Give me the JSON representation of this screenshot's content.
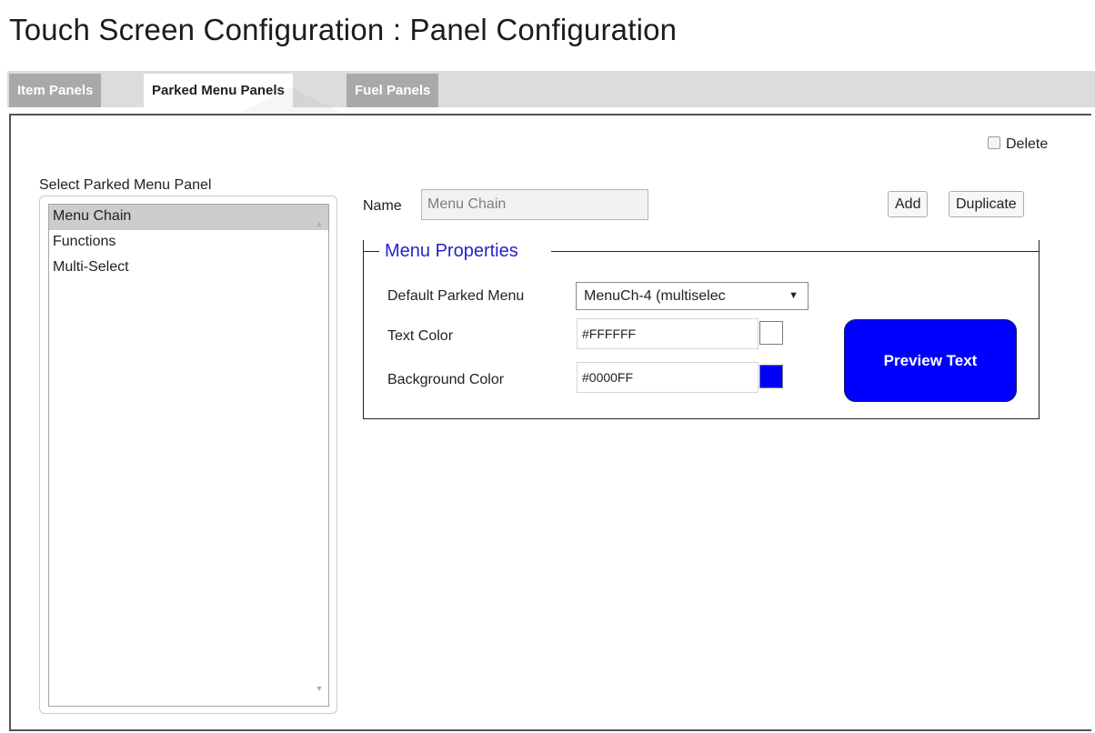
{
  "page": {
    "title": "Touch Screen Configuration : Panel Configuration"
  },
  "tabs": [
    {
      "label": "Item Panels",
      "active": false
    },
    {
      "label": "Parked Menu Panels",
      "active": true
    },
    {
      "label": "Fuel Panels",
      "active": false
    }
  ],
  "delete": {
    "label": "Delete",
    "checked": false
  },
  "panel_list": {
    "label": "Select Parked Menu Panel",
    "items": [
      "Menu Chain",
      "Functions",
      "Multi-Select"
    ],
    "selected": "Menu Chain"
  },
  "name_field": {
    "label": "Name",
    "value": "Menu Chain"
  },
  "buttons": {
    "add": "Add",
    "duplicate": "Duplicate"
  },
  "menu_properties": {
    "legend": "Menu Properties",
    "default_parked_menu": {
      "label": "Default Parked Menu",
      "value": "MenuCh-4 (multiselec"
    },
    "text_color": {
      "label": "Text Color",
      "value": "#FFFFFF"
    },
    "background_color": {
      "label": "Background Color",
      "value": "#0000FF"
    },
    "preview": {
      "label": "Preview Text"
    }
  },
  "colors": {
    "legend_text": "#2424c8",
    "text_swatch": "#FFFFFF",
    "background_swatch": "#0000FF",
    "preview_bg": "#0000FF",
    "preview_text": "#FFFFFF"
  },
  "icons": {
    "dropdown_arrow": "caret-down-icon",
    "scroll_up": "scroll-up-arrow-icon",
    "scroll_down": "scroll-down-arrow-icon",
    "checkbox": "checkbox-icon"
  }
}
